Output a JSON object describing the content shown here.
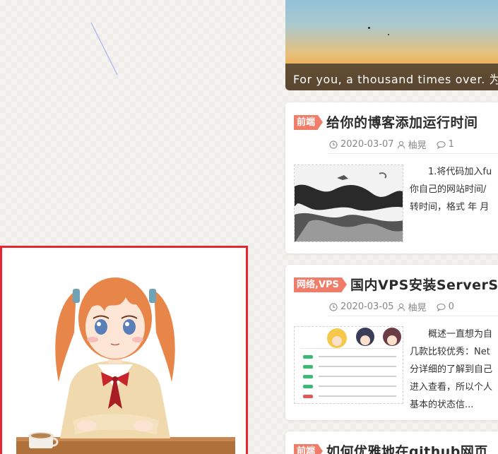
{
  "banner": {
    "caption": "For you, a thousand times over. 为你，千千万万遍"
  },
  "posts": [
    {
      "tag": "前端",
      "title": "给你的博客添加运行时间",
      "date": "2020-03-07",
      "author": "柚晃",
      "comments": "1",
      "excerpt_lines": [
        "　　1.将代码加入fu",
        "你自己的网站时间/",
        "转时间，格式 年 月"
      ]
    },
    {
      "tag": "网络,VPS",
      "title": "国内VPS安装ServerSt",
      "date": "2020-03-05",
      "author": "柚晃",
      "comments": "0",
      "excerpt_lines": [
        "　　概述一直想为自",
        "几款比较优秀：Net",
        "分详细的了解到自己",
        "进入查看，所以个人",
        "基本的状态信..."
      ]
    },
    {
      "tag": "前端",
      "title": "如何优雅地在github网页"
    }
  ],
  "colors": {
    "tag_bg": "#f07c6a",
    "mascot_border": "#e8262f",
    "hair": "#e8864a"
  },
  "icons": [
    "clock-icon",
    "user-icon",
    "comment-icon"
  ]
}
